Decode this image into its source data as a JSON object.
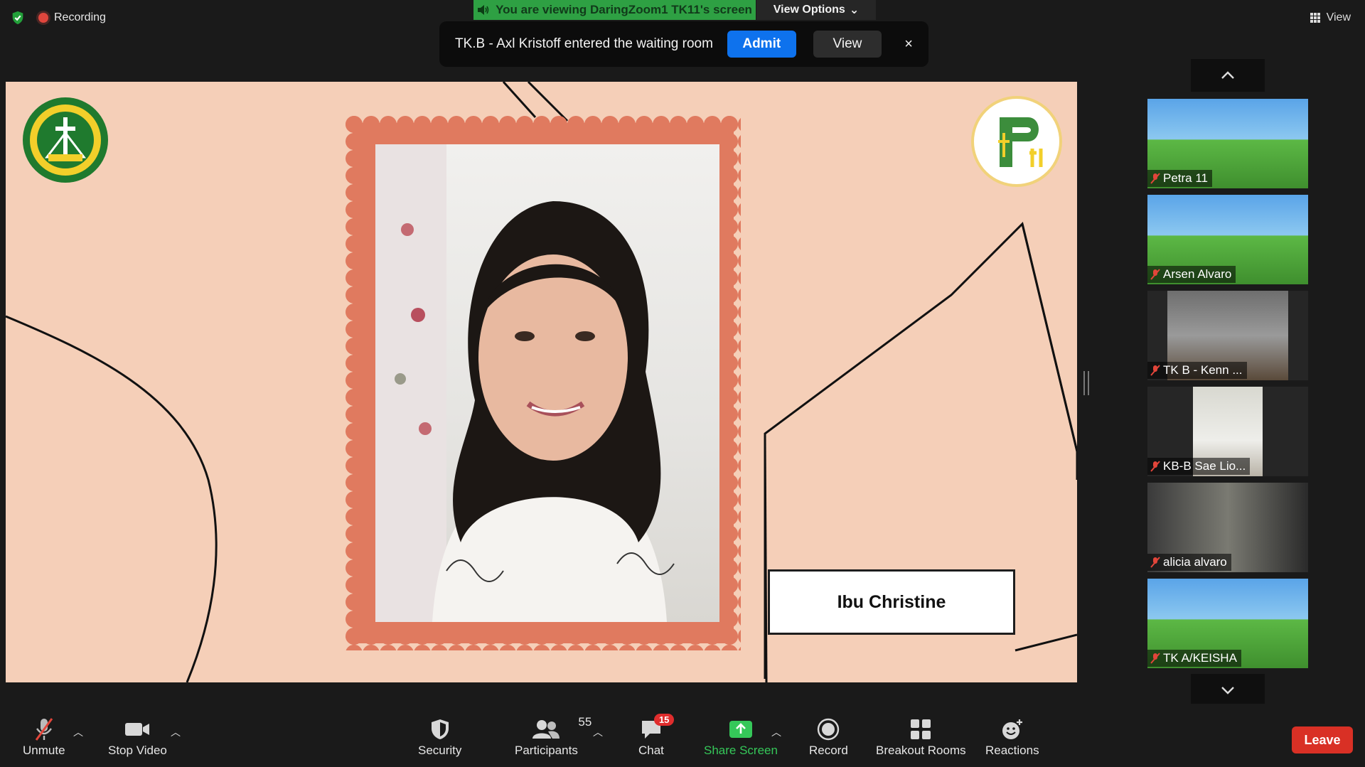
{
  "top": {
    "recording_label": "Recording",
    "viewing_banner": "You are viewing DaringZoom1 TK11's screen",
    "view_options_label": "View Options",
    "view_label": "View"
  },
  "notification": {
    "message": "TK.B -  Axl Kristoff entered the waiting room",
    "admit_label": "Admit",
    "view_label": "View",
    "close_symbol": "×"
  },
  "shared_screen": {
    "name_card": "Ibu Christine",
    "background_color": "#f5cfb8",
    "frame_color": "#e07a5f"
  },
  "participants": [
    {
      "name": "Petra 11",
      "icon": "mic-muted-icon"
    },
    {
      "name": "Arsen Alvaro",
      "icon": "mic-muted-icon"
    },
    {
      "name": "TK B - Kenn ...",
      "icon": "mic-muted-icon"
    },
    {
      "name": "KB-B Sae Lio...",
      "icon": "mic-muted-icon"
    },
    {
      "name": "alicia alvaro",
      "icon": "mic-muted-icon"
    },
    {
      "name": "TK A/KEISHA",
      "icon": "mic-muted-icon"
    }
  ],
  "toolbar": {
    "unmute": "Unmute",
    "stop_video": "Stop Video",
    "security": "Security",
    "participants": "Participants",
    "participants_count": "55",
    "chat": "Chat",
    "chat_badge": "15",
    "share_screen": "Share Screen",
    "record": "Record",
    "breakout_rooms": "Breakout Rooms",
    "reactions": "Reactions",
    "leave": "Leave"
  },
  "colors": {
    "share_green": "#35c759",
    "admit_blue": "#0e72ed",
    "leave_red": "#d93025",
    "banner_green": "#2ea043"
  }
}
